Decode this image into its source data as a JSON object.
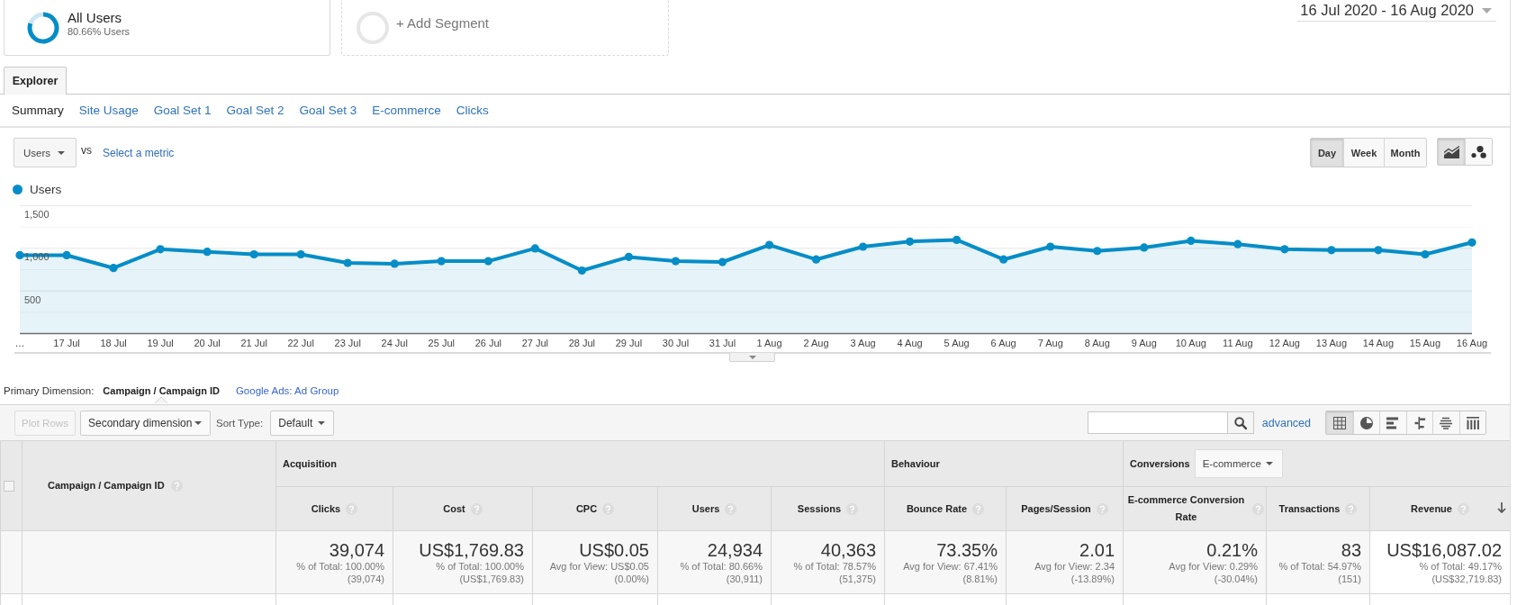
{
  "segments": [
    {
      "kind": "segment",
      "title": "All Users",
      "subtitle": "80.66% Users",
      "chart_data": {
        "type": "donut",
        "values": [
          80.66,
          19.34
        ]
      }
    },
    {
      "kind": "add",
      "title": "+ Add Segment"
    }
  ],
  "date_range": "16 Jul 2020 - 16 Aug 2020",
  "tabs": [
    {
      "label": "Explorer",
      "selected": true
    }
  ],
  "subtabs": [
    {
      "label": "Summary",
      "selected": true
    },
    {
      "label": "Site Usage",
      "selected": false
    },
    {
      "label": "Goal Set 1",
      "selected": false
    },
    {
      "label": "Goal Set 2",
      "selected": false
    },
    {
      "label": "Goal Set 3",
      "selected": false
    },
    {
      "label": "E-commerce",
      "selected": false
    },
    {
      "label": "Clicks",
      "selected": false
    }
  ],
  "metric_selector": {
    "metric": "Users",
    "vs": "vs",
    "compare_link": "Select a metric"
  },
  "intervals": [
    {
      "label": "Day",
      "selected": true
    },
    {
      "label": "Week",
      "selected": false
    },
    {
      "label": "Month",
      "selected": false
    }
  ],
  "chart_types": [
    {
      "kind": "line",
      "selected": true
    },
    {
      "kind": "motion",
      "selected": false
    }
  ],
  "chart": {
    "chart_data": {
      "type": "area",
      "categories": [
        "…",
        "17 Jul",
        "18 Jul",
        "19 Jul",
        "20 Jul",
        "21 Jul",
        "22 Jul",
        "23 Jul",
        "24 Jul",
        "25 Jul",
        "26 Jul",
        "27 Jul",
        "28 Jul",
        "29 Jul",
        "30 Jul",
        "31 Jul",
        "1 Aug",
        "2 Aug",
        "3 Aug",
        "4 Aug",
        "5 Aug",
        "6 Aug",
        "7 Aug",
        "8 Aug",
        "9 Aug",
        "10 Aug",
        "11 Aug",
        "12 Aug",
        "13 Aug",
        "14 Aug",
        "15 Aug",
        "16 Aug"
      ],
      "series": [
        {
          "name": "Users",
          "color": "#058dc7",
          "marker": "circle",
          "values": [
            920,
            920,
            770,
            990,
            960,
            930,
            930,
            830,
            820,
            850,
            850,
            1000,
            740,
            900,
            850,
            840,
            1040,
            870,
            1020,
            1080,
            1100,
            870,
            1020,
            970,
            1010,
            1090,
            1050,
            990,
            980,
            980,
            930,
            1070
          ]
        }
      ],
      "ylim": [
        0,
        1500
      ],
      "yticks": [
        {
          "value": 500,
          "label": "500"
        },
        {
          "value": 1000,
          "label": "1,000"
        },
        {
          "value": 1500,
          "label": "1,500"
        }
      ]
    }
  },
  "primary_dimension": {
    "label": "Primary Dimension:",
    "options": [
      {
        "label": "Campaign / Campaign ID",
        "selected": true
      },
      {
        "label": "Google Ads: Ad Group",
        "selected": false
      }
    ]
  },
  "toolbar": {
    "plot_rows": {
      "label": "Plot Rows",
      "disabled": true
    },
    "secondary_dimension": "Secondary dimension",
    "sort_label": "Sort Type:",
    "sort_type": "Default",
    "advanced_link": "advanced",
    "views": [
      {
        "kind": "table",
        "selected": true
      },
      {
        "kind": "pie",
        "selected": false
      },
      {
        "kind": "performance",
        "selected": false
      },
      {
        "kind": "comparison",
        "selected": false
      },
      {
        "kind": "term_cloud",
        "selected": false
      },
      {
        "kind": "pivot",
        "selected": false
      }
    ]
  },
  "table": {
    "select_all": {
      "checked": false
    },
    "dimension": {
      "label": "Campaign / Campaign ID",
      "help": true
    },
    "groups": [
      {
        "label": "Acquisition",
        "columns": [
          {
            "label": "Clicks",
            "help": true,
            "sorted": false,
            "total": "39,074",
            "notes": [
              "% of Total: 100.00%",
              "(39,074)"
            ]
          },
          {
            "label": "Cost",
            "help": true,
            "sorted": false,
            "total": "US$1,769.83",
            "notes": [
              "% of Total: 100.00%",
              "(US$1,769.83)"
            ]
          },
          {
            "label": "CPC",
            "help": true,
            "sorted": false,
            "total": "US$0.05",
            "notes": [
              "Avg for View: US$0.05",
              "(0.00%)"
            ]
          },
          {
            "label": "Users",
            "help": true,
            "sorted": false,
            "total": "24,934",
            "notes": [
              "% of Total: 80.66%",
              "(30,911)"
            ]
          },
          {
            "label": "Sessions",
            "help": true,
            "sorted": false,
            "total": "40,363",
            "notes": [
              "% of Total: 78.57%",
              "(51,375)"
            ]
          }
        ]
      },
      {
        "label": "Behaviour",
        "columns": [
          {
            "label": "Bounce Rate",
            "help": true,
            "sorted": false,
            "total": "73.35%",
            "notes": [
              "Avg for View: 67.41%",
              "(8.81%)"
            ]
          },
          {
            "label": "Pages/Session",
            "help": true,
            "sorted": false,
            "total": "2.01",
            "notes": [
              "Avg for View: 2.34",
              "(-13.89%)"
            ]
          }
        ]
      },
      {
        "label": "Conversions",
        "dropdown": "E-commerce",
        "columns": [
          {
            "label": "E-commerce Conversion Rate",
            "help": true,
            "sorted": false,
            "total": "0.21%",
            "notes": [
              "Avg for View: 0.29%",
              "(-30.04%)"
            ]
          },
          {
            "label": "Transactions",
            "help": true,
            "sorted": false,
            "total": "83",
            "notes": [
              "% of Total: 54.97%",
              "(151)"
            ]
          },
          {
            "label": "Revenue",
            "help": true,
            "sorted": true,
            "total": "US$16,087.02",
            "notes": [
              "% of Total: 49.17%",
              "(US$32,719.83)"
            ]
          }
        ]
      }
    ]
  }
}
